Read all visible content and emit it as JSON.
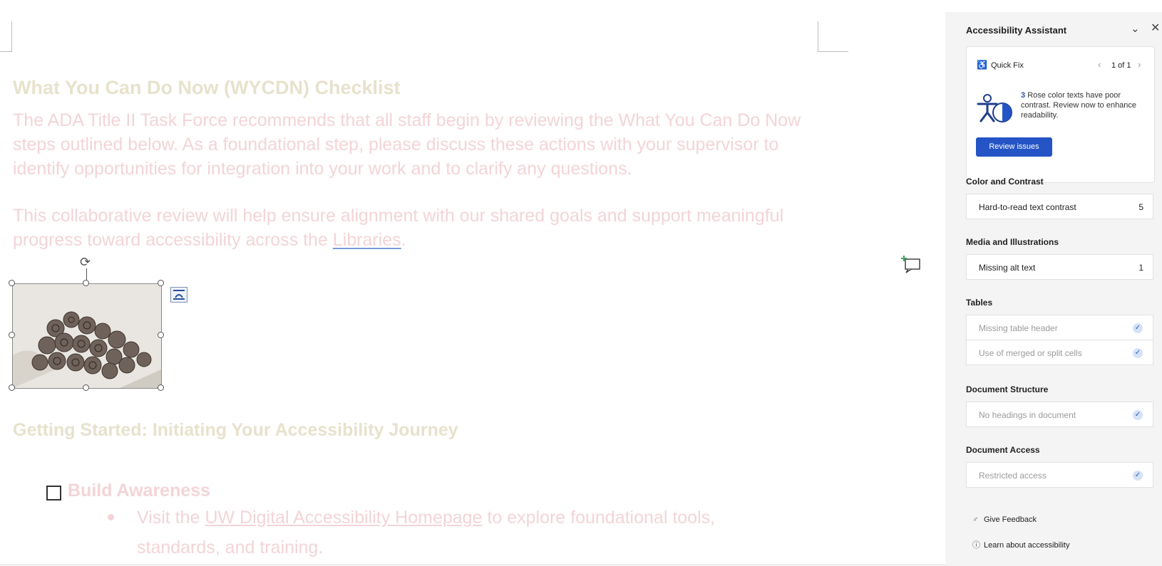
{
  "document": {
    "heading1": "What You Can Do Now (WYCDN) Checklist",
    "para1": "The ADA Title II Task Force recommends that all staff begin by reviewing the What You Can Do Now steps outlined below. As a foundational step, please discuss these actions with your supervisor to identify opportunities for integration into your work and to clarify any questions.",
    "para2_before": "This collaborative review will help ensure alignment with our shared goals and support meaningful progress toward accessibility across the ",
    "para2_link": "Libraries",
    "para2_after": ".",
    "heading2": "Getting Started: Initiating Your Accessibility Journey",
    "checklist_item": "Build Awareness",
    "bullet_before": "Visit the ",
    "bullet_link": "UW Digital Accessibility Homepage",
    "bullet_after": " to explore foundational tools, standards, and training."
  },
  "panel": {
    "title": "Accessibility Assistant",
    "quick_fix": {
      "label": "Quick Fix",
      "pager": "1 of 1",
      "count": "3",
      "description": "Rose color texts have poor contrast. Review now to enhance readability.",
      "button": "Review issues"
    },
    "sections": [
      {
        "title": "Color and Contrast",
        "rows": [
          {
            "label": "Hard-to-read text contrast",
            "count": "5"
          }
        ]
      },
      {
        "title": "Media and Illustrations",
        "rows": [
          {
            "label": "Missing alt text",
            "count": "1"
          }
        ]
      },
      {
        "title": "Tables",
        "rows": [
          {
            "label": "Missing table header"
          },
          {
            "label": "Use of merged or split cells"
          }
        ]
      },
      {
        "title": "Document Structure",
        "rows": [
          {
            "label": "No headings in document"
          }
        ]
      },
      {
        "title": "Document Access",
        "rows": [
          {
            "label": "Restricted access"
          }
        ]
      }
    ],
    "footer": {
      "feedback": "Give Feedback",
      "learn": "Learn about accessibility"
    }
  },
  "colors": {
    "accent": "#2454c5",
    "heading_text": "#e7e2cc",
    "rose_text": "#f3d4d8",
    "panel_bg": "#f4f4f4"
  }
}
